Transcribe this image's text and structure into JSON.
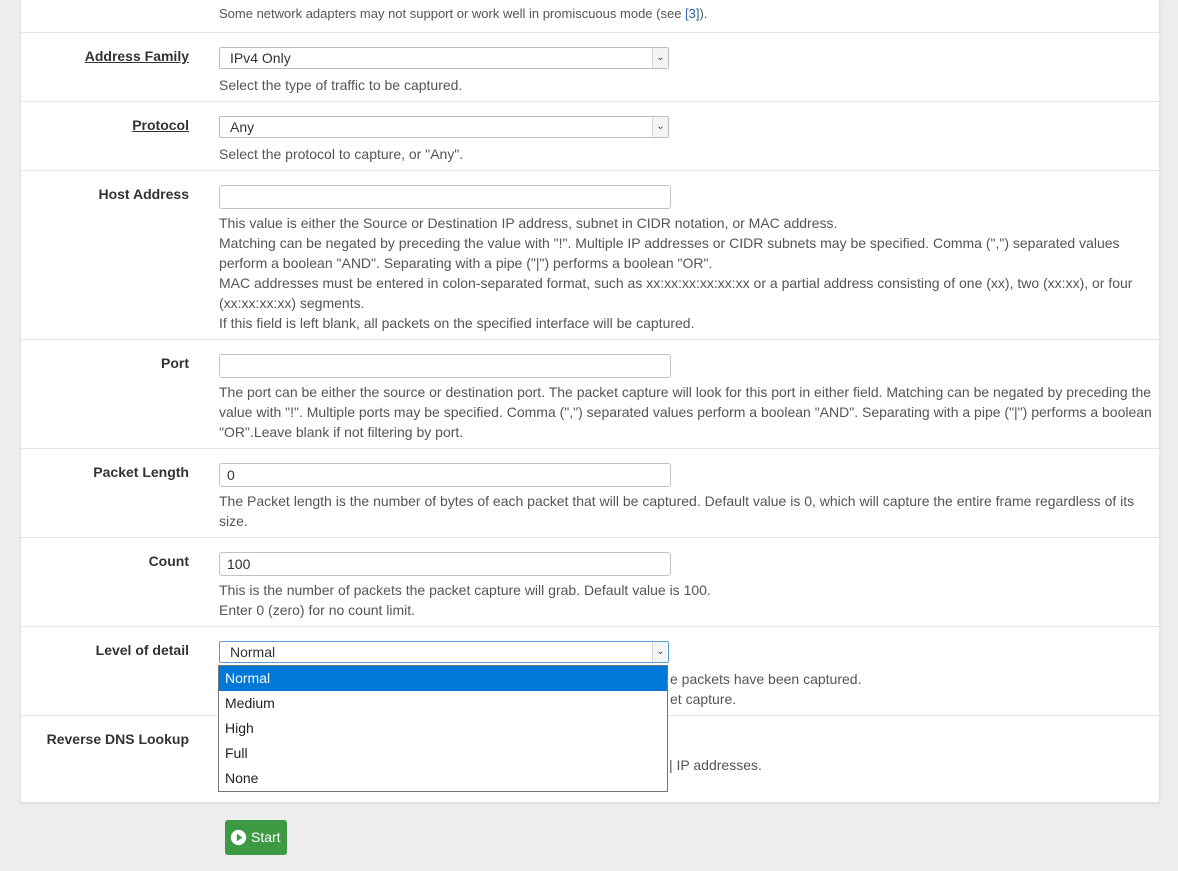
{
  "top_note": {
    "text": "Some network adapters may not support or work well in promiscuous mode (see ",
    "link": "[3]",
    "tail": ")."
  },
  "address_family": {
    "label": "Address Family",
    "value": "IPv4 Only",
    "help": "Select the type of traffic to be captured."
  },
  "protocol": {
    "label": "Protocol",
    "value": "Any",
    "help": "Select the protocol to capture, or \"Any\"."
  },
  "host_address": {
    "label": "Host Address",
    "value": "",
    "help": [
      "This value is either the Source or Destination IP address, subnet in CIDR notation, or MAC address.",
      "Matching can be negated by preceding the value with \"!\". Multiple IP addresses or CIDR subnets may be specified. Comma (\",\") separated values",
      "perform a boolean \"AND\". Separating with a pipe (\"|\") performs a boolean \"OR\".",
      "MAC addresses must be entered in colon-separated format, such as xx:xx:xx:xx:xx:xx or a partial address consisting of one (xx), two (xx:xx), or four",
      "(xx:xx:xx:xx) segments.",
      "If this field is left blank, all packets on the specified interface will be captured."
    ]
  },
  "port": {
    "label": "Port",
    "value": "",
    "help": [
      "The port can be either the source or destination port. The packet capture will look for this port in either field. Matching can be negated by preceding the",
      "value with \"!\". Multiple ports may be specified. Comma (\",\") separated values perform a boolean \"AND\". Separating with a pipe (\"|\") performs a boolean",
      "\"OR\".Leave blank if not filtering by port."
    ]
  },
  "packet_length": {
    "label": "Packet Length",
    "value": "0",
    "help": [
      "The Packet length is the number of bytes of each packet that will be captured. Default value is 0, which will capture the entire frame regardless of its",
      "size."
    ]
  },
  "count": {
    "label": "Count",
    "value": "100",
    "help": [
      "This is the number of packets the packet capture will grab. Default value is 100.",
      "Enter 0 (zero) for no count limit."
    ]
  },
  "level_of_detail": {
    "label": "Level of detail",
    "value": "Normal",
    "help_partial": [
      "e packets have been captured.",
      "et capture."
    ],
    "options": [
      "Normal",
      "Medium",
      "High",
      "Full",
      "None"
    ],
    "selected_index": 0
  },
  "reverse_dns": {
    "label": "Reverse DNS Lookup",
    "help_partial": "| IP addresses."
  },
  "start_button": {
    "label": "Start",
    "color": "#3c9a43",
    "icon": "play-circle-icon"
  }
}
